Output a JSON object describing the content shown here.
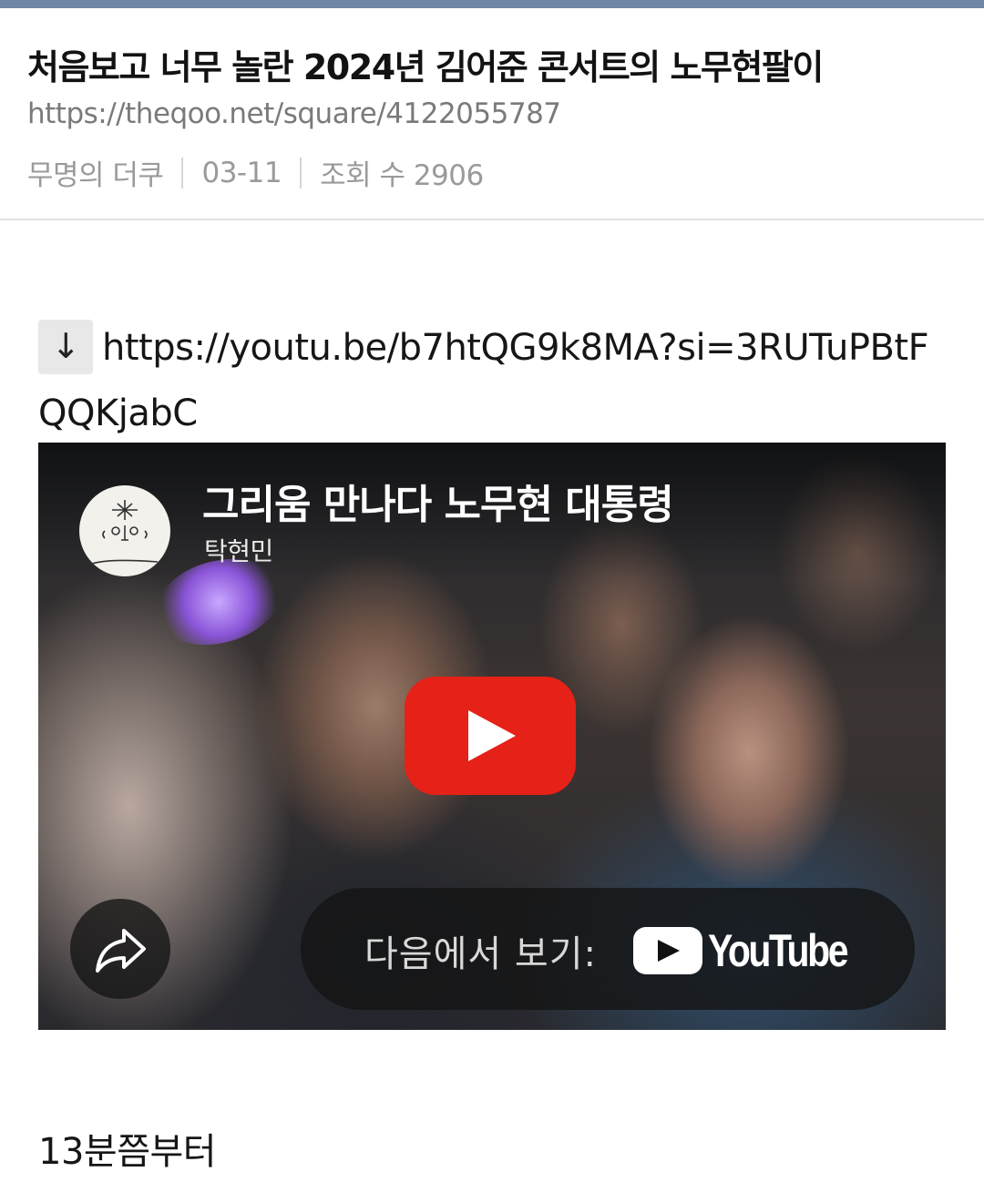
{
  "post": {
    "title": "처음보고 너무 놀란 2024년 김어준 콘서트의 노무현팔이",
    "url": "https://theqoo.net/square/4122055787",
    "author": "무명의 더쿠",
    "date": "03-11",
    "views": "조회 수 2906"
  },
  "content": {
    "arrow": "↓",
    "link": "https://youtu.be/b7htQG9k8MA?si=3RUTuPBtFQQKjabC",
    "text": "13분쯤부터"
  },
  "video": {
    "title": "그리움 만나다 노무현 대통령",
    "channel": "탁현민",
    "watch_label": "다음에서 보기:",
    "platform": "YouTube",
    "play_color": "#e62117"
  },
  "colors": {
    "topbar": "#6f86a4",
    "meta_text": "#9a9a9a"
  }
}
